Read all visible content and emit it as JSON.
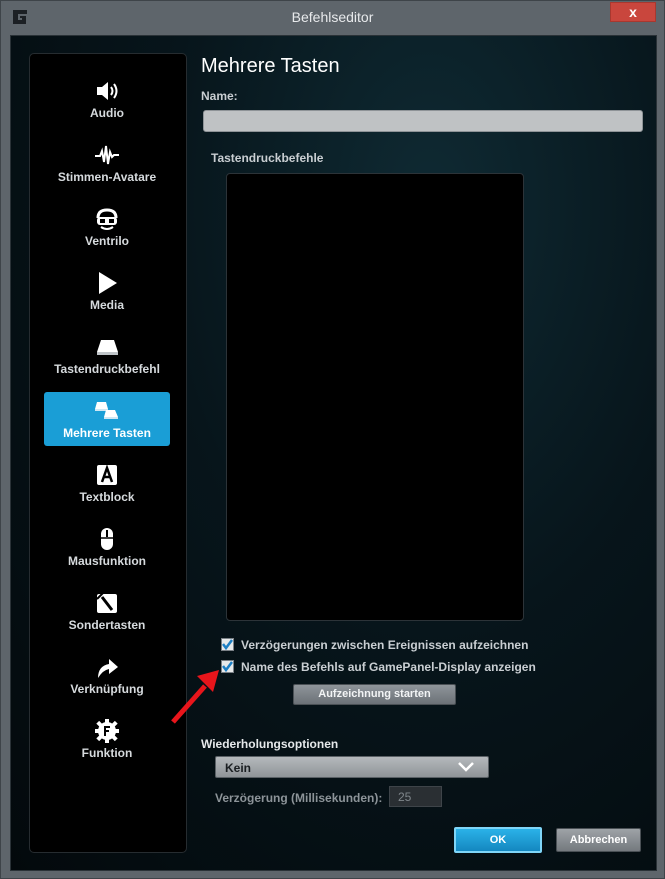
{
  "window": {
    "title": "Befehlseditor",
    "close_symbol": "x",
    "logo_icon": "logitech-g-icon"
  },
  "sidebar": {
    "items": [
      {
        "label": "Audio",
        "icon": "speaker-icon",
        "active": false
      },
      {
        "label": "Stimmen-Avatare",
        "icon": "waveform-icon",
        "active": false
      },
      {
        "label": "Ventrilo",
        "icon": "ventrilo-goggles-icon",
        "active": false
      },
      {
        "label": "Media",
        "icon": "play-icon",
        "active": false
      },
      {
        "label": "Tastendruckbefehl",
        "icon": "key-icon",
        "active": false
      },
      {
        "label": "Mehrere Tasten",
        "icon": "multi-keys-icon",
        "active": true
      },
      {
        "label": "Textblock",
        "icon": "text-block-icon",
        "active": false
      },
      {
        "label": "Mausfunktion",
        "icon": "mouse-icon",
        "active": false
      },
      {
        "label": "Sondertasten",
        "icon": "special-key-icon",
        "active": false
      },
      {
        "label": "Verknüpfung",
        "icon": "shortcut-arrow-icon",
        "active": false
      },
      {
        "label": "Funktion",
        "icon": "function-gear-icon",
        "active": false
      }
    ]
  },
  "main": {
    "heading": "Mehrere Tasten",
    "name_label": "Name:",
    "name_value": "",
    "keystrokes_label": "Tastendruckbefehle",
    "checkboxes": [
      {
        "label": "Verzögerungen zwischen Ereignissen aufzeichnen",
        "checked": true
      },
      {
        "label": "Name des Befehls auf GamePanel-Display anzeigen",
        "checked": true
      }
    ],
    "record_button": "Aufzeichnung starten",
    "repeat_options_label": "Wiederholungsoptionen",
    "repeat_selected": "Kein",
    "delay_label": "Verzögerung (Millisekunden):",
    "delay_value": "25"
  },
  "footer": {
    "ok_label": "OK",
    "cancel_label": "Abbrechen"
  },
  "colors": {
    "accent": "#1a9ed6",
    "annotation_arrow": "#e8151b",
    "titlebar": "#5e656b",
    "close_button": "#c9463d"
  }
}
